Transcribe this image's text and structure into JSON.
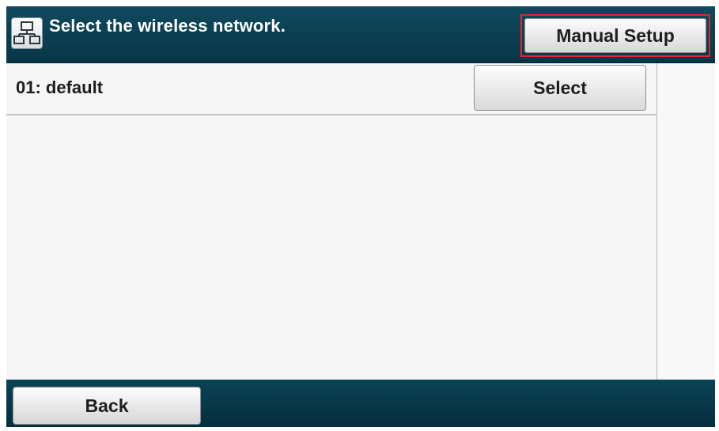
{
  "header": {
    "title": "Select the wireless network.",
    "icon": "network-icon",
    "manual_setup_label": "Manual Setup"
  },
  "networks": [
    {
      "label": "01: default",
      "select_label": "Select"
    }
  ],
  "footer": {
    "back_label": "Back"
  },
  "colors": {
    "header_bg": "#0f4a5e",
    "footer_bg": "#052e3d",
    "highlight": "#e8232a",
    "list_bg": "#f6f6f6"
  }
}
